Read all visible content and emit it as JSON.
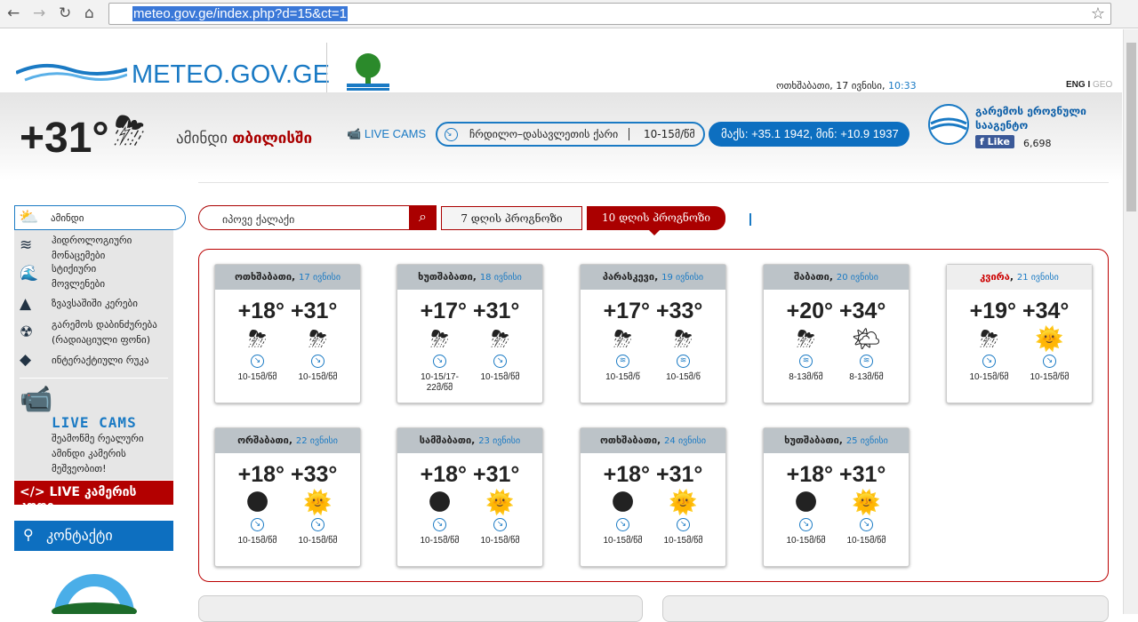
{
  "browser": {
    "url": "meteo.gov.ge/index.php?d=15&ct=1"
  },
  "header": {
    "logo": "METEO.GOV.GE",
    "date": "ოთხშაბათი, 17 ივნისი,",
    "time": "10:33",
    "lang_eng": "ENG",
    "lang_sep": "I",
    "lang_geo": "GEO"
  },
  "current": {
    "temp": "+31°",
    "weather_label": "ამინდი",
    "city": "თბილისში",
    "live_cams": "LIVE CAMS",
    "wind_dir": "ჩრდილო–დასავლეთის ქარი",
    "wind_speed": "10-15მ/წმ",
    "records": "მაქს: +35.1 1942, მინ: +10.9 1937"
  },
  "agency": {
    "name": "გარემოს ეროვნული სააგენტო",
    "like": "Like",
    "likes": "6,698"
  },
  "sidebar": {
    "items": [
      {
        "label": "ამინდი",
        "icon": "cloud-sun-icon"
      },
      {
        "label": "ჰიდროლოგიური მონაცემები",
        "icon": "waves-icon"
      },
      {
        "label": "სტიქიური მოვლენები",
        "icon": "flood-icon"
      },
      {
        "label": "ზვავსაშიში კერები",
        "icon": "avalanche-icon"
      },
      {
        "label": "გარემოს დაბინძურება (რადიაციული ფონი)",
        "icon": "radiation-icon"
      },
      {
        "label": "ინტერაქტიული რუკა",
        "icon": "map-icon"
      }
    ],
    "livecams_title": "LIVE CAMS",
    "livecams_text": "შეამოწმე რეალური ამინდი კამერის მეშვეობით!",
    "livecam_code": "</> LIVE კამერის კოდი",
    "contact": "კონტაქტი"
  },
  "search": {
    "placeholder": "იპოვე ქალაქი"
  },
  "tabs": {
    "seven": "7 დღის პროგნოზი",
    "ten": "10 დღის პროგნოზი"
  },
  "forecast": [
    {
      "day": "ოთხშაბათი",
      "date": "17 ივნისი",
      "min": "+18°",
      "max": "+31°",
      "icons": [
        "storm",
        "storm"
      ],
      "winds": [
        "10-15მ/წმ",
        "10-15მ/წმ"
      ],
      "dir": [
        "se",
        "se"
      ]
    },
    {
      "day": "ხუთშაბათი",
      "date": "18 ივნისი",
      "min": "+17°",
      "max": "+31°",
      "icons": [
        "storm",
        "storm"
      ],
      "winds": [
        "10-15/17-22მ/წმ",
        "10-15მ/წმ"
      ],
      "dir": [
        "se",
        "se"
      ]
    },
    {
      "day": "პარასკევი",
      "date": "19 ივნისი",
      "min": "+17°",
      "max": "+33°",
      "icons": [
        "storm",
        "storm"
      ],
      "winds": [
        "10-15მ/წ",
        "10-15მ/წ"
      ],
      "dir": [
        "var",
        "var"
      ]
    },
    {
      "day": "შაბათი",
      "date": "20 ივნისი",
      "min": "+20°",
      "max": "+34°",
      "icons": [
        "storm",
        "partly"
      ],
      "winds": [
        "8-13მ/წმ",
        "8-13მ/წმ"
      ],
      "dir": [
        "var",
        "var"
      ]
    },
    {
      "day": "კვირა",
      "date": "21 ივნისი",
      "min": "+19°",
      "max": "+34°",
      "icons": [
        "storm",
        "sun"
      ],
      "winds": [
        "10-15მ/წმ",
        "10-15მ/წმ"
      ],
      "dir": [
        "se",
        "se"
      ],
      "weekend": true
    },
    {
      "day": "ორშაბათი",
      "date": "22 ივნისი",
      "min": "+18°",
      "max": "+33°",
      "icons": [
        "moon",
        "sun"
      ],
      "winds": [
        "10-15მ/წმ",
        "10-15მ/წმ"
      ],
      "dir": [
        "se",
        "se"
      ]
    },
    {
      "day": "სამშაბათი",
      "date": "23 ივნისი",
      "min": "+18°",
      "max": "+31°",
      "icons": [
        "moon",
        "sun"
      ],
      "winds": [
        "10-15მ/წმ",
        "10-15მ/წმ"
      ],
      "dir": [
        "se",
        "se"
      ]
    },
    {
      "day": "ოთხშაბათი",
      "date": "24 ივნისი",
      "min": "+18°",
      "max": "+31°",
      "icons": [
        "moon",
        "sun"
      ],
      "winds": [
        "10-15მ/წმ",
        "10-15მ/წმ"
      ],
      "dir": [
        "se",
        "se"
      ]
    },
    {
      "day": "ხუთშაბათი",
      "date": "25 ივნისი",
      "min": "+18°",
      "max": "+31°",
      "icons": [
        "moon",
        "sun"
      ],
      "winds": [
        "10-15მ/წმ",
        "10-15მ/წმ"
      ],
      "dir": [
        "se",
        "se"
      ]
    }
  ]
}
